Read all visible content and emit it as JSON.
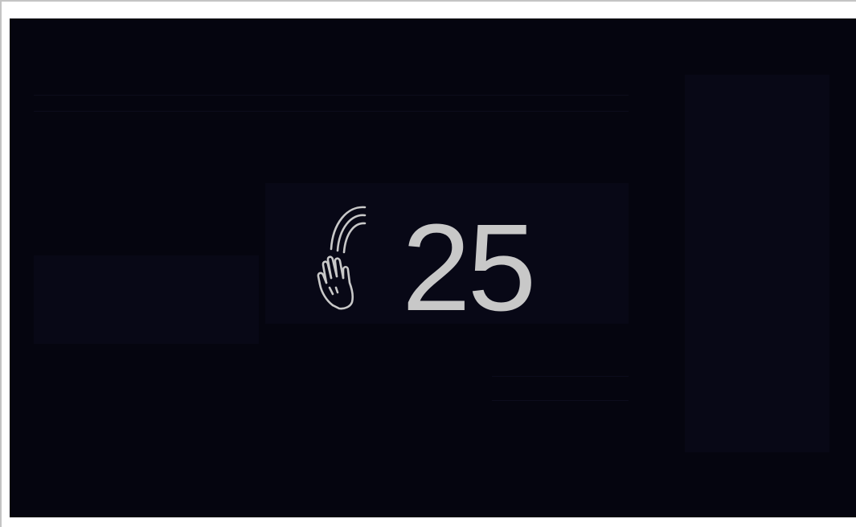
{
  "gesture": {
    "icon": "wave-hand-icon",
    "countdown_value": "25"
  },
  "colors": {
    "screen_background": "#05050f",
    "foreground": "#c8c8c8"
  }
}
